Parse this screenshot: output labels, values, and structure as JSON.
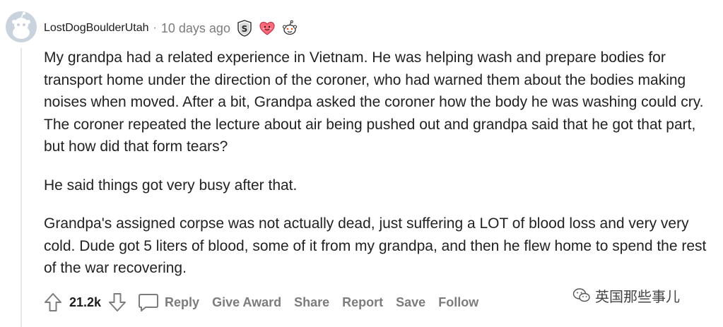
{
  "comment": {
    "username": "LostDogBoulderUtah",
    "separator": "·",
    "timestamp": "10 days ago",
    "awards": [
      "silver-award-icon",
      "wholesome-heart-award-icon",
      "snoo-hug-award-icon"
    ],
    "paragraphs": [
      "My grandpa had a related experience in Vietnam. He was helping wash and prepare bodies for transport home under the direction of the coroner, who had warned them about the bodies making noises when moved. After a bit, Grandpa asked the coroner how the body he was washing could cry. The coroner repeated the lecture about air being pushed out and grandpa said that he got that part, but how did that form tears?",
      "He said things got very busy after that.",
      "Grandpa's assigned corpse was not actually dead, just suffering a LOT of blood loss and very very cold. Dude got 5 liters of blood, some of it from my grandpa, and then he flew home to spend the rest of the war recovering."
    ]
  },
  "actions": {
    "score": "21.2k",
    "reply": "Reply",
    "give_award": "Give Award",
    "share": "Share",
    "report": "Report",
    "save": "Save",
    "follow": "Follow"
  },
  "watermark": {
    "text": "英国那些事儿"
  },
  "colors": {
    "text": "#1c1c1c",
    "muted": "#7c7c7c",
    "avatar_bg": "#c9d3dd",
    "thread_line": "#e6e6e6"
  }
}
